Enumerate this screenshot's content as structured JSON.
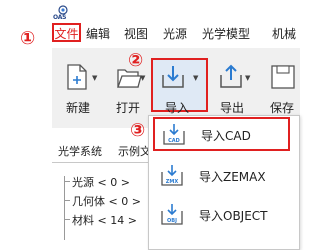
{
  "app": {
    "logo_text": "OAS"
  },
  "menu": {
    "items": [
      "文件",
      "编辑",
      "视图",
      "光源",
      "光学模型",
      "机械"
    ]
  },
  "ribbon": {
    "new_label": "新建",
    "open_label": "打开",
    "import_label": "导入",
    "export_label": "导出",
    "save_label": "保存"
  },
  "markers": {
    "one": "①",
    "two": "②",
    "three": "③"
  },
  "panel": {
    "tabs": [
      "光学系统",
      "示例文"
    ],
    "tree": [
      "光源 < 0 >",
      "几何体 < 0 >",
      "材料 < 14 >"
    ]
  },
  "import_menu": {
    "items": [
      {
        "label": "导入CAD",
        "icon_text": "CAD"
      },
      {
        "label": "导入ZEMAX",
        "icon_text": "ZMX"
      },
      {
        "label": "导入OBJECT",
        "icon_text": "OBJ"
      }
    ]
  },
  "colors": {
    "accent": "#e02020",
    "icon_blue": "#2b7bd0",
    "ribbon_bg": "#f0f0f0"
  }
}
